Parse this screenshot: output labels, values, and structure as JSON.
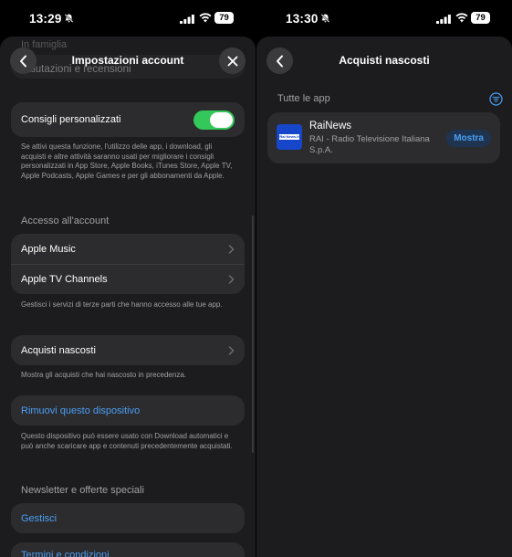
{
  "left": {
    "status": {
      "time": "13:29",
      "battery": "79"
    },
    "nav": {
      "title": "Impostazioni account"
    },
    "ghost_section_label": "In famiglia",
    "ghost_row_label": "Valutazioni e recensioni",
    "personalized": {
      "label": "Consigli personalizzati",
      "on": true,
      "footnote": "Se attivi questa funzione, l'utilizzo delle app, i download, gli acquisti e altre attività saranno usati per migliorare i consigli personalizzati in App Store, Apple Books, iTunes Store, Apple TV, Apple Podcasts, Apple Games e per gli abbonamenti da Apple."
    },
    "account_access": {
      "header": "Accesso all'account",
      "items": [
        {
          "label": "Apple Music"
        },
        {
          "label": "Apple TV Channels"
        }
      ],
      "footnote": "Gestisci i servizi di terze parti che hanno accesso alle tue app."
    },
    "hidden_purchases": {
      "label": "Acquisti nascosti",
      "footnote": "Mostra gli acquisti che hai nascosto in precedenza."
    },
    "remove_device": {
      "label": "Rimuovi questo dispositivo",
      "footnote": "Questo dispositivo può essere usato con Download automatici e può anche scaricare app e contenuti precedentemente acquistati."
    },
    "newsletter": {
      "header": "Newsletter e offerte speciali",
      "manage_label": "Gestisci",
      "terms_label": "Termini e condizioni"
    }
  },
  "right": {
    "status": {
      "time": "13:30",
      "battery": "79"
    },
    "nav": {
      "title": "Acquisti nascosti"
    },
    "section_header": "Tutte le app",
    "app": {
      "name": "RaiNews",
      "developer": "RAI - Radio Televisione Italiana S.p.A.",
      "icon_text": "Rai News.it",
      "action_label": "Mostra"
    }
  },
  "colors": {
    "background": "#000000",
    "sheet": "#1c1c1e",
    "card": "#2c2c2e",
    "accent_blue": "#4a9ff5",
    "toggle_green": "#34c759",
    "secondary_text": "#a1a1a6"
  },
  "icons": [
    "silent-bell-icon",
    "signal-icon",
    "wifi-icon",
    "battery-icon",
    "back-chevron-icon",
    "close-icon",
    "chevron-right-icon",
    "filter-icon"
  ]
}
